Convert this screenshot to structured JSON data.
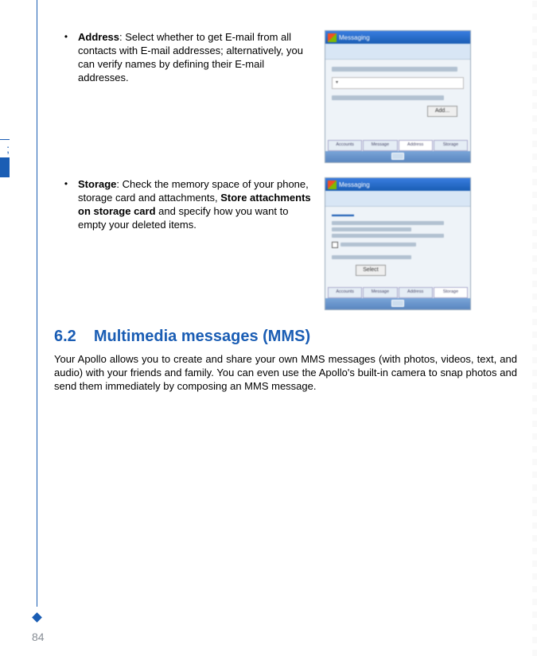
{
  "bullets": [
    {
      "label": "Address",
      "text": ": Select whether to get E-mail from all contacts with E-mail addresses; alternatively, you can verify names by defining their E-mail addresses."
    },
    {
      "label": "Storage",
      "text_before_bold": ": Check the memory space of your phone, storage card and attachments, ",
      "bold_inner": "Store attachments on storage card",
      "text_after_bold": " and specify how you want to empty your deleted items."
    }
  ],
  "screenshots": {
    "s1": {
      "title": "Messaging",
      "btn": "Add...",
      "tabs": [
        "Accounts",
        "Message",
        "Address",
        "Storage"
      ]
    },
    "s2": {
      "title": "Messaging",
      "btn": "Select",
      "tabs": [
        "Accounts",
        "Message",
        "Address",
        "Storage"
      ]
    }
  },
  "section": {
    "number": "6.2",
    "title": "Multimedia messages (MMS)",
    "body": "Your Apollo allows you to create and share your own MMS messages (with photos, videos, text, and audio) with your friends and family. You can even use the Apollo's built-in camera to snap photos and send them immediately by composing an MMS message."
  },
  "pageNumber": "84",
  "sideTabChar": ";"
}
